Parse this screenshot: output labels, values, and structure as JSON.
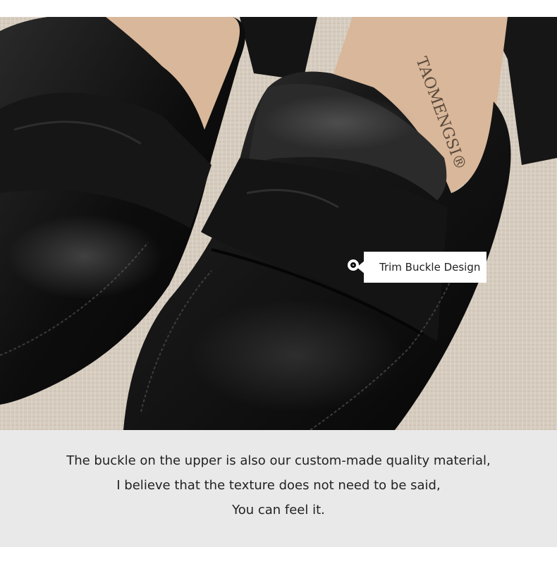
{
  "photo": {
    "subject": "black leather penny loafers",
    "insole_brand": "TAOMENGSI®",
    "colors": {
      "leather": "#111111",
      "background_fabric": "#d8cfc2",
      "insole": "#d9b79a"
    }
  },
  "callout": {
    "label": "Trim Buckle Design",
    "icon": "dot-marker-icon"
  },
  "caption": {
    "lines": [
      "The buckle on the upper is also our custom-made quality material,",
      "I believe that the texture does not need to be said,",
      "You can feel it."
    ],
    "background": "#e9e9e9"
  }
}
